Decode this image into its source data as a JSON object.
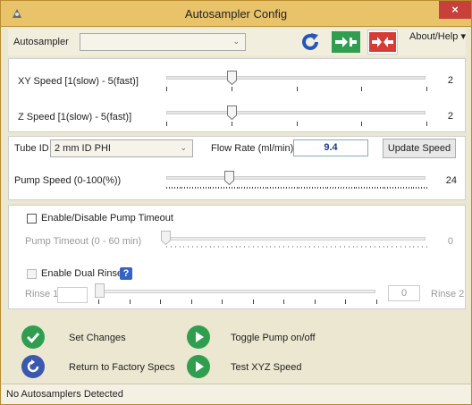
{
  "window": {
    "title": "Autosampler Config",
    "close_label": "×"
  },
  "toolbar": {
    "autosampler_label": "Autosampler",
    "autosampler_value": "",
    "about_label": "About/Help ▾"
  },
  "speeds": {
    "xy_label": "XY Speed [1(slow) - 5(fast)]",
    "xy_value": "2",
    "xy_level_fraction": 0.25,
    "z_label": "Z Speed [1(slow) - 5(fast)]",
    "z_value": "2",
    "z_level_fraction": 0.25
  },
  "pump": {
    "tube_label": "Tube ID",
    "tube_value": "2 mm ID PHI",
    "flow_label": "Flow Rate (ml/min)=",
    "flow_value": "9.4",
    "update_label": "Update Speed",
    "speed_label": "Pump Speed (0-100(%))",
    "speed_value": "24",
    "speed_level_fraction": 0.24
  },
  "timeout": {
    "enable_label": "Enable/Disable Pump Timeout",
    "timeout_label": "Pump Timeout (0 - 60 min)",
    "timeout_value": "0",
    "dual_rinse_label": "Enable Dual Rinse",
    "help_icon_label": "?",
    "rinse1_label": "Rinse 1",
    "rinse1_value": "",
    "rinse2_label": "Rinse 2",
    "rinse2_value": "0"
  },
  "actions": {
    "set_changes": "Set Changes",
    "toggle_pump": "Toggle Pump on/off",
    "factory": "Return to Factory Specs",
    "test_xyz": "Test XYZ Speed"
  },
  "status": {
    "text": "No Autosamplers Detected"
  },
  "colors": {
    "green": "#2f9e4f",
    "blue": "#3b58b0",
    "red": "#d63b35",
    "refresh": "#2556b8"
  }
}
